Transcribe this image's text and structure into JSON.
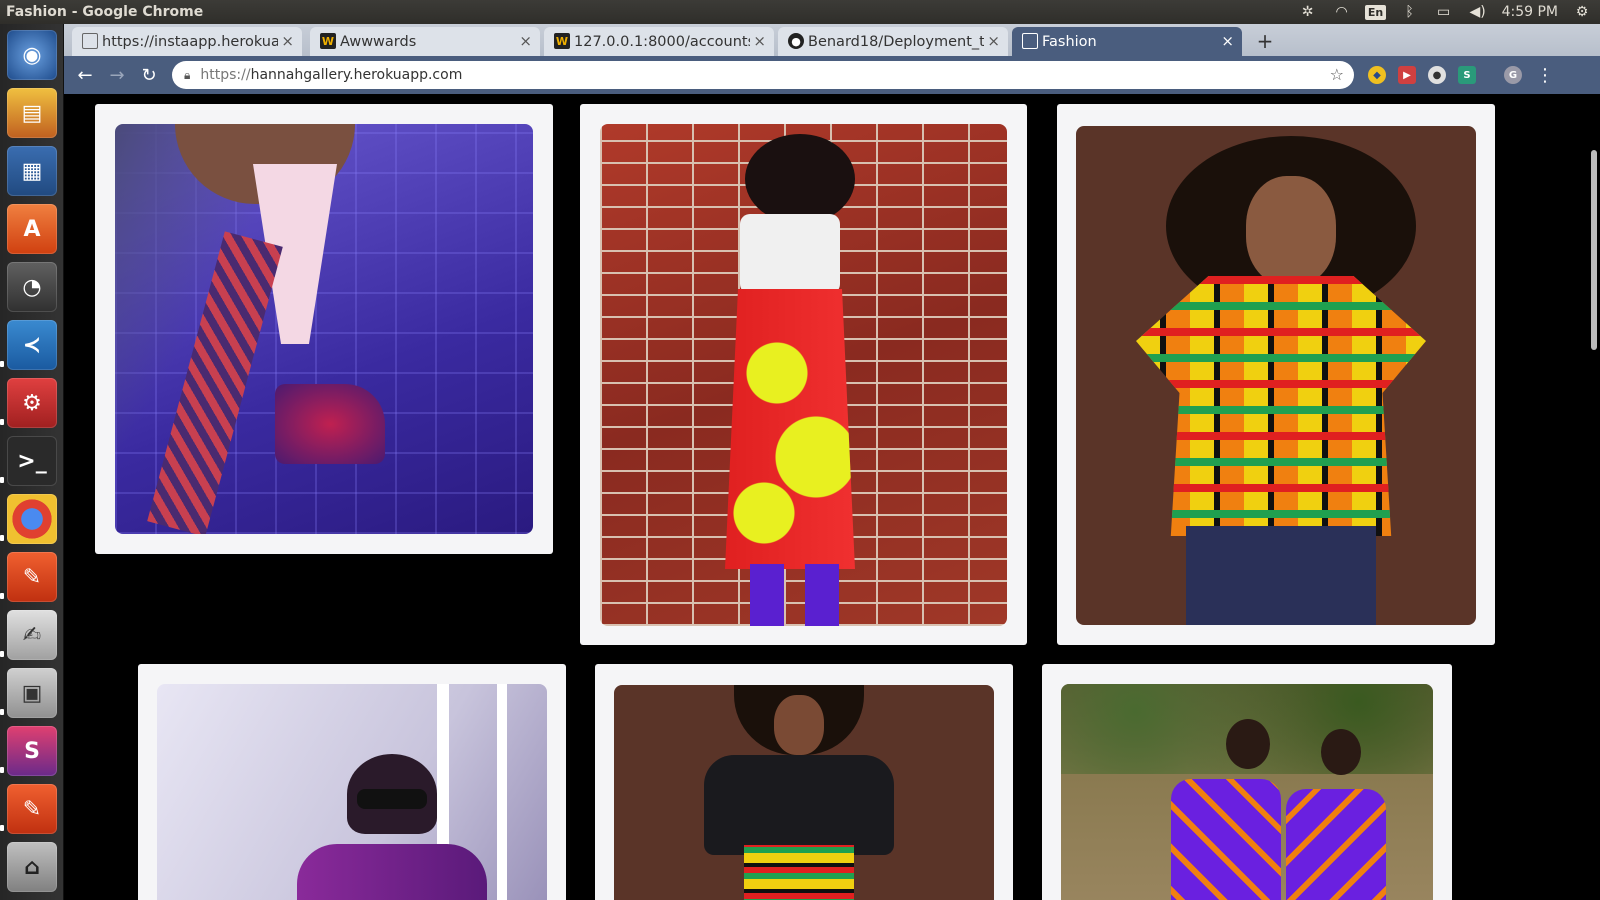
{
  "window": {
    "title": "Fashion - Google Chrome"
  },
  "panel": {
    "keyboard_layout": "En",
    "clock": "4:59 PM"
  },
  "tabs": [
    {
      "label": "https://instaapp.herokua",
      "favicon": "page-icon"
    },
    {
      "label": "Awwwards",
      "favicon": "awwwards-icon"
    },
    {
      "label": "127.0.0.1:8000/accounts/",
      "favicon": "awwwards-icon"
    },
    {
      "label": "Benard18/Deployment_t",
      "favicon": "github-icon"
    },
    {
      "label": "Fashion",
      "favicon": "page-icon",
      "active": true
    }
  ],
  "omnibox": {
    "url_prefix": "https://",
    "url_host": "hannahgallery.herokuapp.com"
  },
  "profile": {
    "initial": "G"
  },
  "extensions": {
    "s_label": "S"
  },
  "gallery": [
    {
      "subject": "purple plaid suit with tie and pocket square"
    },
    {
      "subject": "woman in print skirt against brick wall"
    },
    {
      "subject": "woman in kente peplum top"
    },
    {
      "subject": "woman with sunglasses near window"
    },
    {
      "subject": "woman in black top with kente skirt"
    },
    {
      "subject": "two women in purple print dresses"
    }
  ],
  "colors": {
    "chrome_accent": "#4a5d7e",
    "page_bg": "#000000",
    "card_bg": "#f5f5f7"
  }
}
